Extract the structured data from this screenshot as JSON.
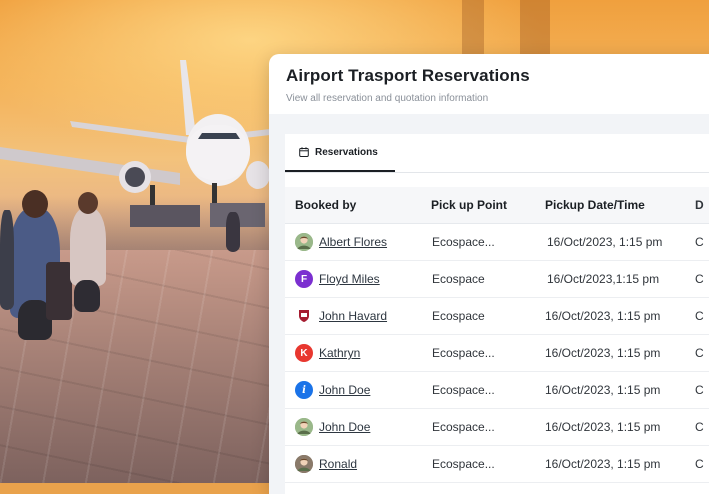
{
  "panel": {
    "title": "Airport Trasport Reservations",
    "subtitle": "View all reservation and quotation information"
  },
  "tabs": [
    {
      "label": "Reservations",
      "icon": "calendar-icon",
      "active": true
    }
  ],
  "table": {
    "headers": [
      "Booked by",
      "Pick up Point",
      "Pickup Date/Time",
      "D"
    ],
    "rows": [
      {
        "name": "Albert Flores",
        "avatar": {
          "type": "photo",
          "color": "#9ab88a"
        },
        "pickup": "Ecospace...",
        "datetime": "16/Oct/2023, 1:15 pm",
        "extra": "C"
      },
      {
        "name": "Floyd Miles",
        "avatar": {
          "type": "letter",
          "letter": "F",
          "color": "#7b2fd0"
        },
        "pickup": "Ecospace",
        "datetime": "16/Oct/2023,1:15 pm",
        "extra": "C"
      },
      {
        "name": "John Havard",
        "avatar": {
          "type": "crest",
          "color": "#a51c30"
        },
        "pickup": "Ecospace",
        "datetime": "16/Oct/2023, 1:15 pm",
        "extra": "C"
      },
      {
        "name": "Kathryn",
        "avatar": {
          "type": "letter",
          "letter": "K",
          "color": "#e8372f"
        },
        "pickup": "Ecospace...",
        "datetime": "16/Oct/2023, 1:15 pm",
        "extra": "C"
      },
      {
        "name": "John Doe",
        "avatar": {
          "type": "info",
          "letter": "i",
          "color": "#1a73e8"
        },
        "pickup": "Ecospace...",
        "datetime": "16/Oct/2023, 1:15 pm",
        "extra": "C"
      },
      {
        "name": "John Doe",
        "avatar": {
          "type": "photo",
          "color": "#9ab88a"
        },
        "pickup": "Ecospace...",
        "datetime": "16/Oct/2023, 1:15 pm",
        "extra": "C"
      },
      {
        "name": "Ronald",
        "avatar": {
          "type": "photo",
          "color": "#8a7a6a"
        },
        "pickup": "Ecospace...",
        "datetime": "16/Oct/2023, 1:15 pm",
        "extra": "C"
      }
    ]
  }
}
